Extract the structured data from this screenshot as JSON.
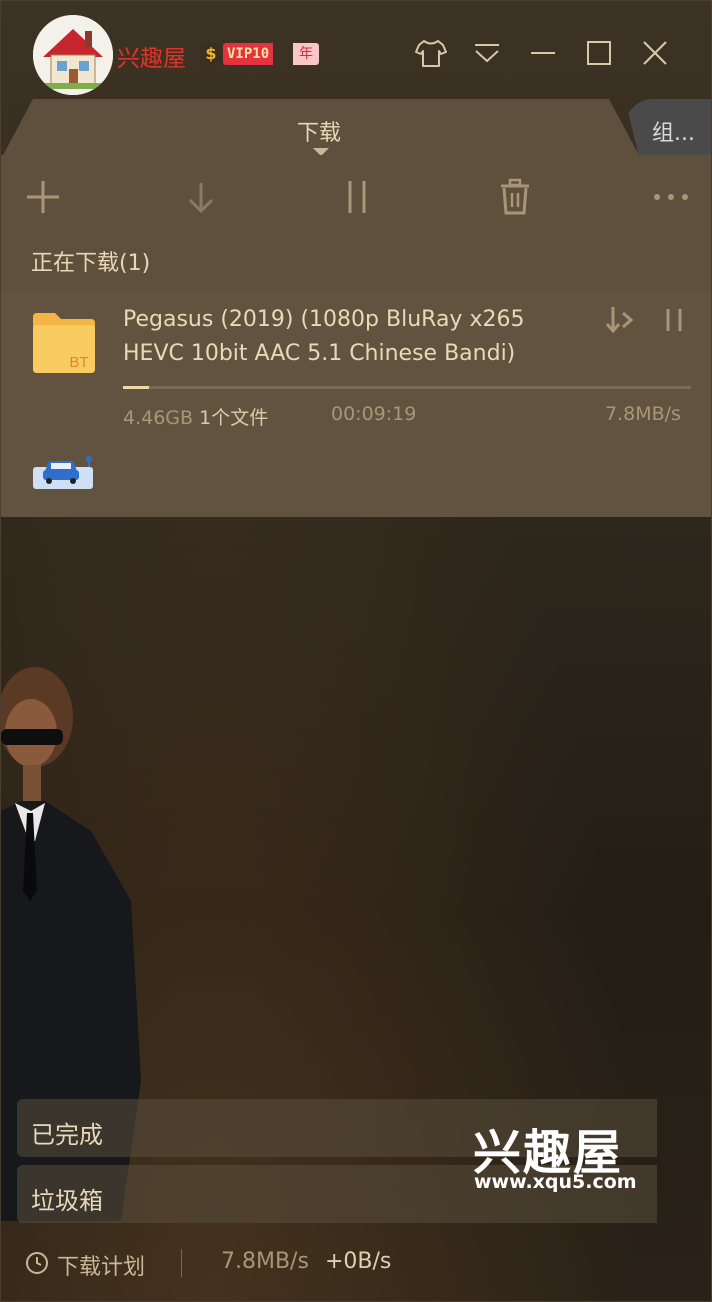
{
  "app": {
    "brand": "兴趣屋",
    "coin": "$",
    "vip": "VIP10",
    "vip_term": "年"
  },
  "tabs": [
    {
      "label": "下载",
      "active": true
    },
    {
      "label": "组..."
    }
  ],
  "toolbar": {
    "icons": [
      "plus-icon",
      "download-arrow-icon",
      "pause-icon",
      "trash-icon",
      "more-icon"
    ]
  },
  "section": {
    "downloading_title": "正在下载(1)"
  },
  "download_item": {
    "type_badge": "BT",
    "title_line1": "Pegasus (2019) (1080p BluRay x265",
    "title_line2": "HEVC 10bit AAC 5.1 Chinese Bandi)",
    "size": "4.46GB",
    "files": "1个文件",
    "remaining_time": "00:09:19",
    "speed": "7.8MB/s",
    "progress": 0.045
  },
  "bottom_nav": {
    "completed": "已完成",
    "trash": "垃圾箱"
  },
  "watermark": {
    "title": "兴趣屋",
    "url": "www.xqu5.com"
  },
  "status_bar": {
    "plan": "下载计划",
    "download_speed": "7.8MB/s",
    "upload_speed": "+0B/s"
  },
  "colors": {
    "accent": "#f0d8a8",
    "brand_red": "#e0332b",
    "panel": "#5e503d"
  }
}
